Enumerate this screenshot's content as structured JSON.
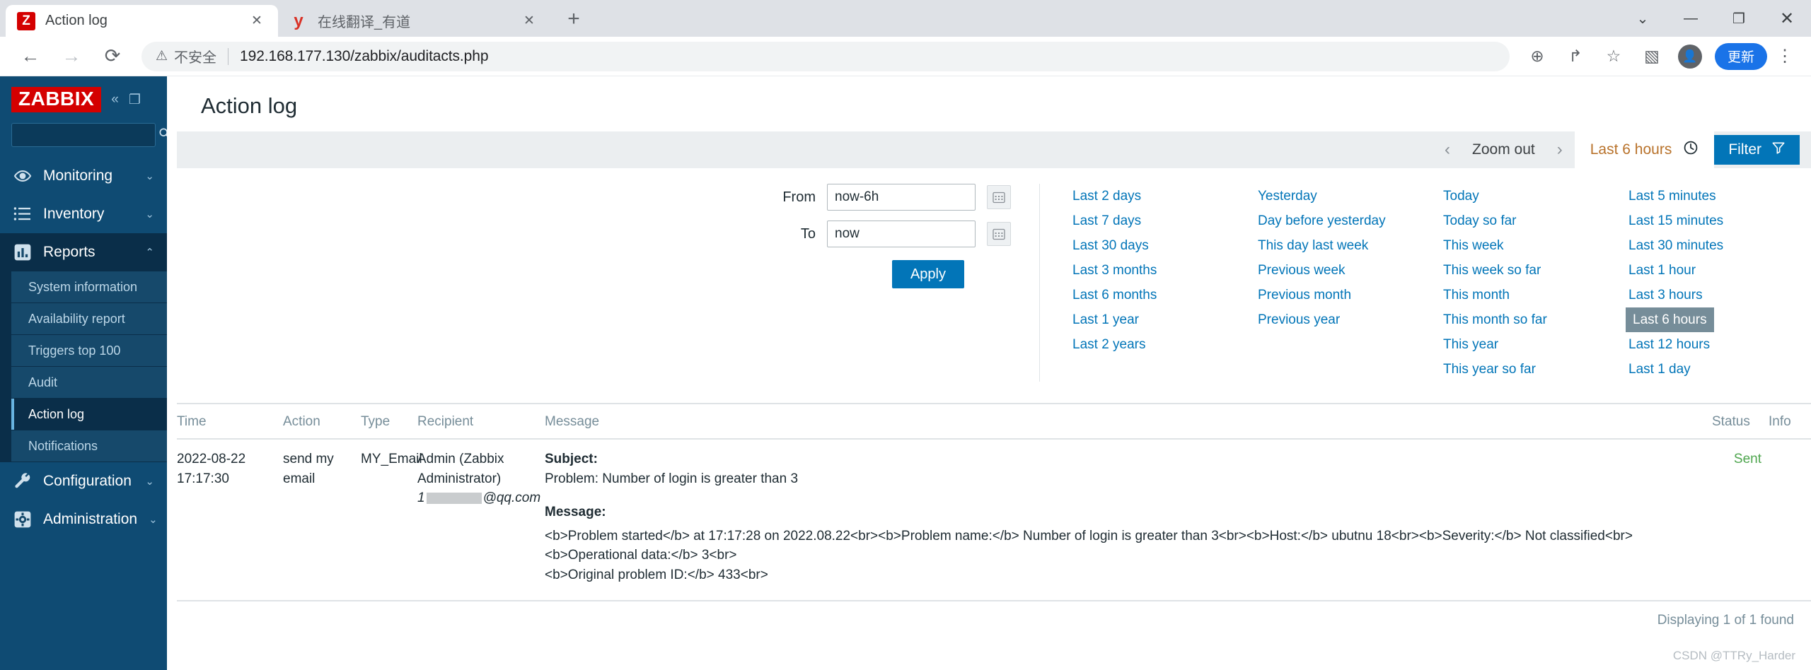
{
  "browser": {
    "tabs": [
      {
        "title": "Action log",
        "favicon": "zabbix-favicon",
        "favicon_char": "Z",
        "active": true,
        "close_label": "✕"
      },
      {
        "title": "在线翻译_有道",
        "favicon": "youdao-favicon",
        "favicon_char": "y",
        "active": false,
        "close_label": "✕"
      }
    ],
    "new_tab_label": "+",
    "window_controls": {
      "minimize": "—",
      "maximize": "❐",
      "close": "✕",
      "tab_search": "⌄"
    },
    "nav": {
      "back": "←",
      "forward": "→",
      "reload": "⟳"
    },
    "omnibox": {
      "security_label": "不安全",
      "warning_icon": "⚠",
      "url": "192.168.177.130/zabbix/auditacts.php"
    },
    "toolbar": {
      "zoom_icon": "⊕",
      "share_icon": "↱",
      "bookmark_icon": "☆",
      "sidepanel_icon": "▧",
      "profile_icon": "●",
      "update_label": "更新",
      "menu_icon": "⋮"
    }
  },
  "sidebar": {
    "logo": "ZABBIX",
    "collapse_icon": "«",
    "hide_icon": "❐",
    "search": {
      "placeholder": "",
      "value": "",
      "icon": "search-icon"
    },
    "nav": [
      {
        "label": "Monitoring",
        "icon": "eye-icon",
        "chevron": "⌄",
        "state": "collapsed"
      },
      {
        "label": "Inventory",
        "icon": "list-icon",
        "chevron": "⌄",
        "state": "collapsed"
      },
      {
        "label": "Reports",
        "icon": "bar-chart-icon",
        "chevron": "⌃",
        "state": "expanded"
      }
    ],
    "reports_submenu": [
      {
        "label": "System information",
        "selected": false
      },
      {
        "label": "Availability report",
        "selected": false
      },
      {
        "label": "Triggers top 100",
        "selected": false
      },
      {
        "label": "Audit",
        "selected": false
      },
      {
        "label": "Action log",
        "selected": true
      },
      {
        "label": "Notifications",
        "selected": false
      }
    ],
    "nav_bottom": [
      {
        "label": "Configuration",
        "icon": "wrench-icon",
        "chevron": "⌄",
        "state": "collapsed"
      },
      {
        "label": "Administration",
        "icon": "gear-icon",
        "chevron": "⌄",
        "state": "collapsed"
      }
    ]
  },
  "main": {
    "title": "Action log",
    "toolbar": {
      "prev_arrow": "‹",
      "zoom_out": "Zoom out",
      "next_arrow": "›",
      "range_label": "Last 6 hours",
      "clock_icon": "◴",
      "filter_label": "Filter",
      "funnel_icon": "▽"
    },
    "time_filter": {
      "from_label": "From",
      "from_value": "now-6h",
      "to_label": "To",
      "to_value": "now",
      "calendar_icon": "☷",
      "apply_label": "Apply",
      "quick_ranges": [
        [
          "Last 2 days",
          "Last 7 days",
          "Last 30 days",
          "Last 3 months",
          "Last 6 months",
          "Last 1 year",
          "Last 2 years"
        ],
        [
          "Yesterday",
          "Day before yesterday",
          "This day last week",
          "Previous week",
          "Previous month",
          "Previous year"
        ],
        [
          "Today",
          "Today so far",
          "This week",
          "This week so far",
          "This month",
          "This month so far",
          "This year",
          "This year so far"
        ],
        [
          "Last 5 minutes",
          "Last 15 minutes",
          "Last 30 minutes",
          "Last 1 hour",
          "Last 3 hours",
          "Last 6 hours",
          "Last 12 hours",
          "Last 1 day"
        ]
      ],
      "active_range": "Last 6 hours"
    },
    "table": {
      "headers": [
        "Time",
        "Action",
        "Type",
        "Recipient",
        "Message",
        "Status",
        "Info"
      ],
      "rows": [
        {
          "time_date": "2022-08-22",
          "time_clock": "17:17:30",
          "action_line1": "send my",
          "action_line2": "email",
          "type": "MY_Email",
          "recipient_name": "Admin (Zabbix",
          "recipient_name2": "Administrator)",
          "recipient_email_prefix": "1",
          "recipient_email_suffix": "@qq.com",
          "subject_label": "Subject:",
          "subject_text": "Problem: Number of login is greater than 3",
          "message_label": "Message:",
          "message_line1": "<b>Problem started</b> at 17:17:28 on 2022.08.22<br><b>Problem name:</b> Number of login is greater than 3<br><b>Host:</b> ubutnu 18<br><b>Severity:</b> Not classified<br><b>Operational data:</b> 3<br>",
          "message_line2": "<b>Original problem ID:</b> 433<br>",
          "status": "Sent",
          "info": ""
        }
      ],
      "footer": "Displaying 1 of 1 found"
    },
    "watermark": "CSDN @TTRy_Harder"
  },
  "colors": {
    "zabbix_red": "#d40000",
    "sidebar_blue": "#0f4b73",
    "sidebar_dark": "#0a2e49",
    "accent_blue": "#0275b8",
    "range_orange": "#b8722b",
    "status_green": "#4fa64f"
  }
}
